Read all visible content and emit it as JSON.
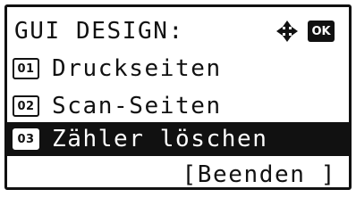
{
  "header": {
    "title": "GUI DESIGN:",
    "nav_icon": "four-way-arrow-icon",
    "ok_label": "OK"
  },
  "menu": {
    "items": [
      {
        "number": "01",
        "label": "Druckseiten",
        "selected": false
      },
      {
        "number": "02",
        "label": "Scan-Seiten",
        "selected": false
      },
      {
        "number": "03",
        "label": "Zähler löschen",
        "selected": true
      }
    ]
  },
  "footer": {
    "end_label": "[Beenden ]"
  },
  "colors": {
    "foreground": "#111111",
    "background": "#ffffff"
  }
}
